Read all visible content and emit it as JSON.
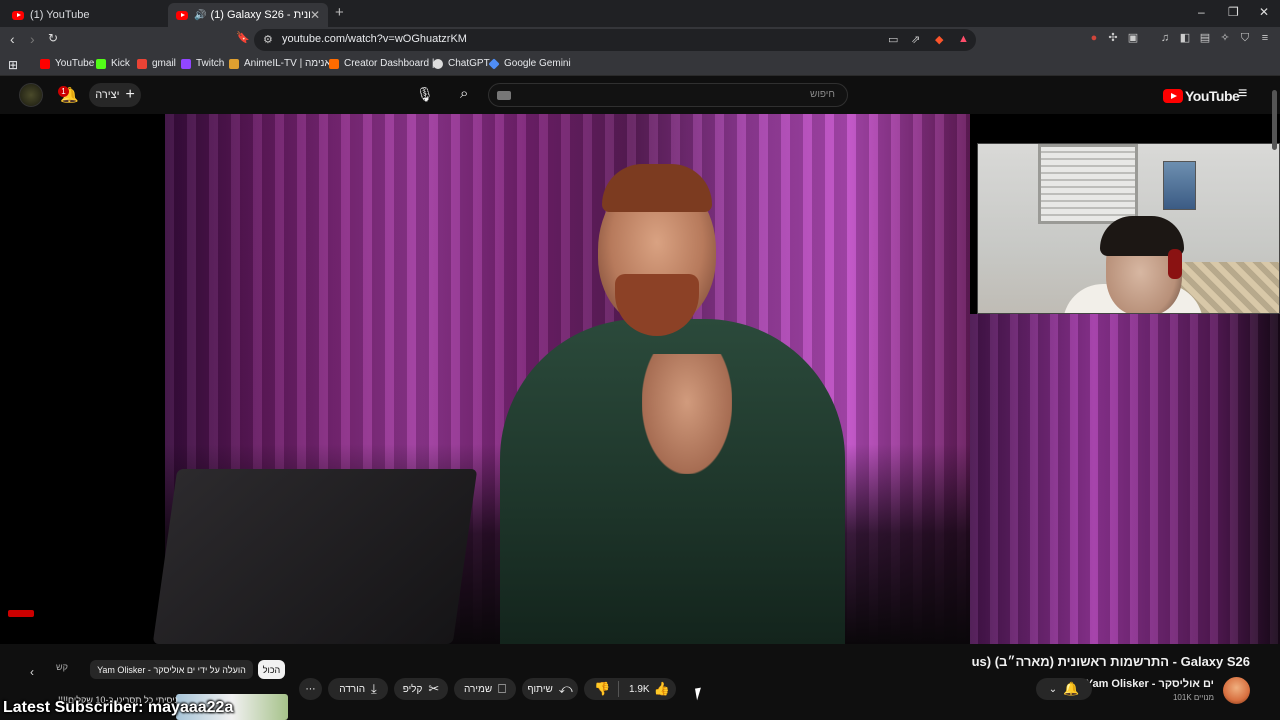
{
  "browser": {
    "tabs": [
      {
        "title": "(1) YouTube"
      },
      {
        "title": "(1) Galaxy S26 - התרשמות ראשונית"
      }
    ],
    "url": "youtube.com/watch?v=wOGhuatzrKM",
    "window_controls": {
      "minimize": "–",
      "restore": "❐",
      "close": "✕"
    },
    "bookmarks": [
      {
        "label": "YouTube",
        "color": "#ff0000"
      },
      {
        "label": "Kick",
        "color": "#53fc18"
      },
      {
        "label": "gmail",
        "color": "#ea4335"
      },
      {
        "label": "Twitch",
        "color": "#9146ff"
      },
      {
        "label": "AnimeIL-TV | אנימה...",
        "color": "#e0a030"
      },
      {
        "label": "Creator Dashboard |...",
        "color": "#ff6b00"
      },
      {
        "label": "ChatGPT",
        "color": "#dddddd"
      },
      {
        "label": "Google Gemini",
        "color": "#4f8df5"
      }
    ]
  },
  "youtube": {
    "create_label": "יצירה",
    "notification_count": "1",
    "search_placeholder": "חיפוש",
    "logo_text": "YouTube",
    "video": {
      "title": "Galaxy S26 - התרשמות ראשונית (מארה״ב) (us",
      "channel": "Yam Olisker - ים אוליסקר",
      "subscribers": "101K מנויים",
      "likes": "1.9K",
      "actions": {
        "share": "שיתוף",
        "save": "שמירה",
        "clip": "קליפ",
        "download": "הורדה",
        "more": "⋯"
      }
    },
    "chips": {
      "all": "הכול",
      "uploaded_by": "Yam Olisker - הועלה על ידי ים אוליסקר",
      "related": "קש"
    },
    "recommendation_title": "ניסיתי כל תסריט ב-10 שקלים!!!!",
    "stream_overlay": "Latest Subscriber: mayaaa22a"
  },
  "colors": {
    "brand_red": "#ff0000",
    "background": "#0f0f0f",
    "pill": "#272727"
  }
}
